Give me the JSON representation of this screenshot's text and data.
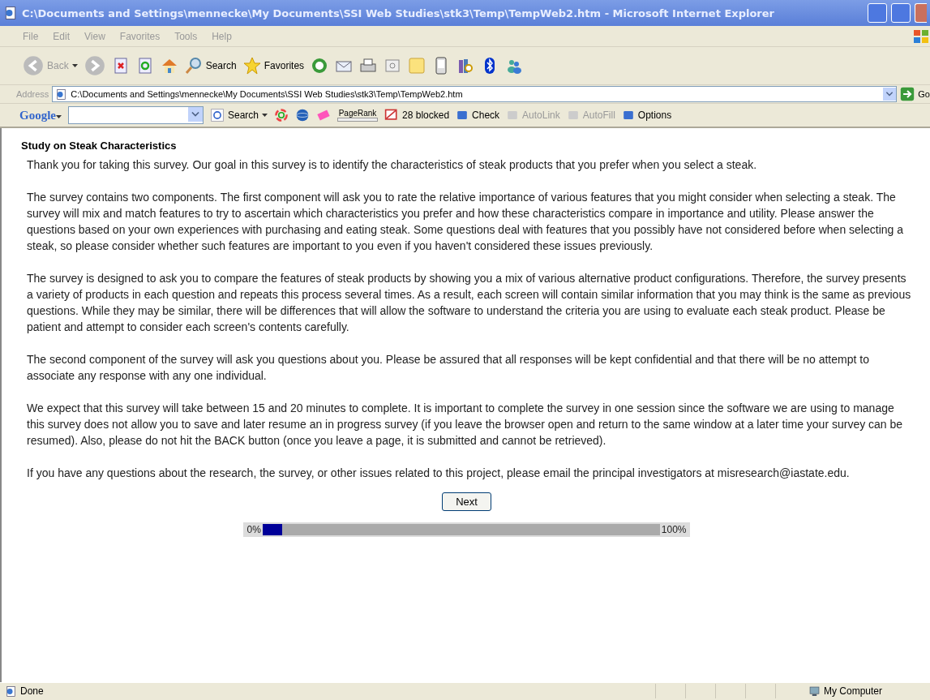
{
  "window": {
    "title": "C:\\Documents and Settings\\mennecke\\My Documents\\SSI Web Studies\\stk3\\Temp\\TempWeb2.htm - Microsoft Internet Explorer"
  },
  "menu": [
    "File",
    "Edit",
    "View",
    "Favorites",
    "Tools",
    "Help"
  ],
  "toolbar": {
    "back": "Back",
    "search": "Search",
    "favorites": "Favorites"
  },
  "address": {
    "label": "Address",
    "value": "C:\\Documents and Settings\\mennecke\\My Documents\\SSI Web Studies\\stk3\\Temp\\TempWeb2.htm",
    "go": "Go"
  },
  "google_bar": {
    "logo": "Google",
    "search": "Search",
    "pagerank": "PageRank",
    "blocked": "28 blocked",
    "items": [
      {
        "label": "Check",
        "disabled": false
      },
      {
        "label": "AutoLink",
        "disabled": true
      },
      {
        "label": "AutoFill",
        "disabled": true
      },
      {
        "label": "Options",
        "disabled": false
      }
    ]
  },
  "page": {
    "heading": "Study on Steak Characteristics",
    "paragraphs": [
      "Thank you for taking this survey. Our goal in this survey is to identify the characteristics of steak products that you prefer when you select a steak.",
      "The survey contains two components. The first component will ask you to rate the relative importance of various features that you might consider when selecting a steak. The survey will mix and match features to try to ascertain which characteristics you prefer and how these characteristics compare in importance and utility. Please answer the questions based on your own experiences with purchasing and eating steak. Some questions deal with features that you possibly have not considered before when selecting a steak, so please consider whether such features are important to you even if you haven't considered these issues previously.",
      "The survey is designed to ask you to compare the features of steak products by showing you a mix of various alternative product configurations. Therefore, the survey presents a variety of products in each question and repeats this process several times. As a result, each screen will contain similar information that you may think is the same as previous questions. While they may be similar, there will be differences that will allow the software to understand the criteria you are using to evaluate each steak product. Please be patient and attempt to consider each screen's contents carefully.",
      "The second component of the survey will ask you questions about you. Please be assured that all responses will be kept confidential and that there will be no attempt to associate any response with any one individual.",
      "We expect that this survey will take between 15 and 20 minutes to complete. It is important to complete the survey in one session since the software we are using to manage this survey does not allow you to save and later resume an in progress survey (if you leave the browser open and return to the same window at a later time your survey can be resumed). Also, please do not hit the BACK button (once you leave a page, it is submitted and cannot be retrieved).",
      "If you have any questions about the research, the survey, or other issues related to this project, please email the principal investigators at misresearch@iastate.edu."
    ],
    "next": "Next",
    "progress": {
      "start": "0%",
      "end": "100%",
      "level": 0.05
    }
  },
  "status_bar": {
    "text": "Done",
    "zone": "My Computer"
  }
}
